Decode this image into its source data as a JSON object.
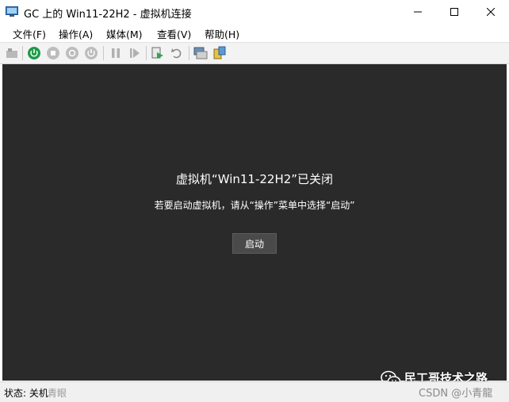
{
  "window": {
    "title": "GC 上的 Win11-22H2 - 虚拟机连接"
  },
  "menu": {
    "items": [
      "文件(F)",
      "操作(A)",
      "媒体(M)",
      "查看(V)",
      "帮助(H)"
    ]
  },
  "toolbar": {
    "icons": [
      "ctrl-alt-del-icon",
      "start-icon",
      "turn-off-icon",
      "shut-down-icon",
      "save-state-icon",
      "pause-icon",
      "resume-icon",
      "checkpoint-icon",
      "revert-icon",
      "enhanced-session-icon",
      "share-icon"
    ]
  },
  "vm": {
    "heading": "虚拟机“Win11-22H2”已关闭",
    "hint": "若要启动虚拟机，请从“操作”菜单中选择“启动”",
    "start_label": "启动"
  },
  "status": {
    "text": "状态: 关机",
    "ghost": "青眼"
  },
  "watermark": {
    "title": "民工哥技术之路",
    "csdn": "CSDN @小青龍"
  },
  "colors": {
    "vm_background": "#2a2a2a",
    "start_button": "#4a4a4a",
    "toolbar_green": "#1e9a4a"
  }
}
